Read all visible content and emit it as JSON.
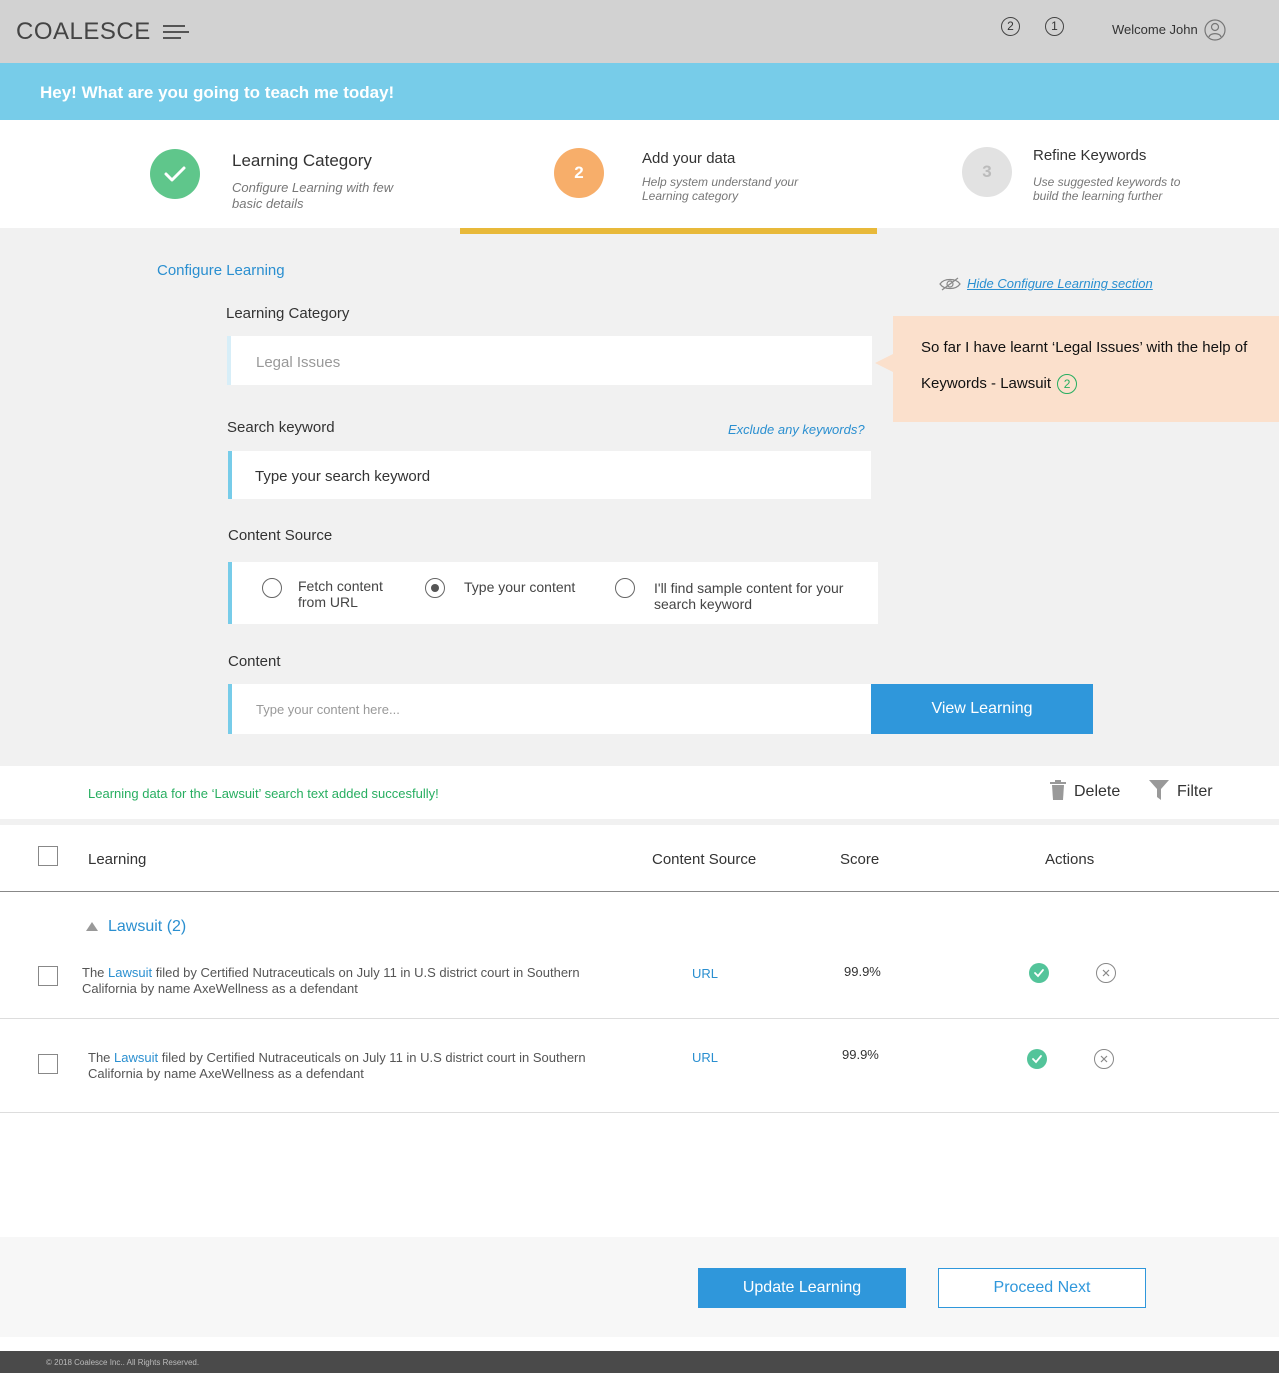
{
  "header": {
    "logo": "COALESCE",
    "notifications": [
      "2",
      "1"
    ],
    "welcome": "Welcome John"
  },
  "banner": {
    "text": "Hey! What are you going to teach me today!"
  },
  "stepper": {
    "steps": [
      {
        "number": "",
        "title": "Learning Category",
        "desc_line1": "Configure Learning with few",
        "desc_line2": "basic details",
        "status": "done",
        "color": "#5fc68b"
      },
      {
        "number": "2",
        "title": "Add your data",
        "desc_line1": "Help system understand your",
        "desc_line2": "Learning category",
        "status": "active",
        "color": "#f7ae6a"
      },
      {
        "number": "3",
        "title": "Refine Keywords",
        "desc_line1": "Use suggested keywords to",
        "desc_line2": "build the learning further",
        "status": "pending",
        "color": "#e2e2e2"
      }
    ],
    "progress_color": "#e8b93a"
  },
  "configure": {
    "title": "Configure Learning",
    "hide_link": "Hide Configure Learning section",
    "category_label": "Learning Category",
    "category_value": "Legal Issues",
    "search_label": "Search keyword",
    "search_placeholder": "Type your search keyword",
    "exclude_link": "Exclude any keywords?",
    "source_label": "Content Source",
    "source_options": [
      {
        "line1": "Fetch content",
        "line2": "from URL",
        "checked": false
      },
      {
        "line1": "Type your content",
        "line2": "",
        "checked": true
      },
      {
        "line1": "I'll find sample content for your",
        "line2": "search keyword",
        "checked": false
      }
    ],
    "content_label": "Content",
    "content_placeholder": "Type your content here...",
    "view_button": "View Learning"
  },
  "callout": {
    "line1": "So far I have learnt ‘Legal Issues’ with the help of",
    "line2": "Keywords - Lawsuit",
    "badge": "2"
  },
  "status": {
    "message": "Learning data for the ‘Lawsuit’ search text added succesfully!",
    "delete_label": "Delete",
    "filter_label": "Filter"
  },
  "table": {
    "headers": {
      "learning": "Learning",
      "source": "Content Source",
      "score": "Score",
      "actions": "Actions"
    },
    "group": "Lawsuit (2)",
    "rows": [
      {
        "pre": "The ",
        "keyword": "Lawsuit",
        "post": " filed by Certified Nutraceuticals on July 11 in U.S district court in Southern",
        "line2": "California by name AxeWellness as a defendant",
        "source": "URL",
        "score": "99.9%"
      },
      {
        "pre": "The ",
        "keyword": "Lawsuit",
        "post": " filed by Certified Nutraceuticals on July 11 in U.S district court in Southern",
        "line2": "California by name AxeWellness as a defendant",
        "source": "URL",
        "score": "99.9%"
      }
    ]
  },
  "footer": {
    "update_button": "Update Learning",
    "proceed_button": "Proceed Next",
    "copyright": "© 2018 Coalesce Inc.. All Rights Reserved."
  },
  "colors": {
    "accent": "#2f97db",
    "banner": "#77cce9",
    "success": "#27ae60",
    "callout": "#fbe0cc"
  }
}
